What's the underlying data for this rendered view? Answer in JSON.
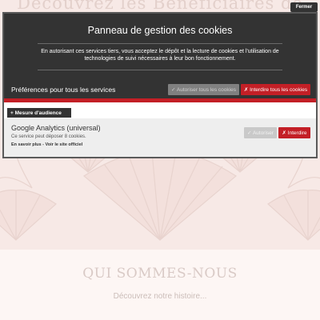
{
  "site": {
    "hero_title": "Découvrez les Bénéficiaires de l'Âme",
    "about_title": "QUI SOMMES-NOUS",
    "about_subtitle": "Découvrez notre histoire..."
  },
  "cookie_panel": {
    "close_label": "Fermer",
    "title": "Panneau de gestion des cookies",
    "intro": "En autorisant ces services tiers, vous acceptez le dépôt et la lecture de cookies et l'utilisation de technologies de suivi nécessaires à leur bon fonctionnement.",
    "preferences_label": "Préférences pour tous les services",
    "allow_all_label": "✓ Autoriser tous les cookies",
    "deny_all_label": "✗ Interdire tous les cookies",
    "category": {
      "label": "+ Mesure d'audience"
    },
    "service": {
      "name": "Google Analytics (universal)",
      "description": "Ce service peut déposer 8 cookies.",
      "learn_more": "En savoir plus",
      "separator": " - ",
      "official_site": "Voir le site officiel",
      "allow_label": "✓ Autoriser",
      "deny_label": "✗ Interdire"
    }
  },
  "colors": {
    "panel_dark": "#333333",
    "accent_red": "#c31f26",
    "hero_bg": "#f7e9e6"
  }
}
